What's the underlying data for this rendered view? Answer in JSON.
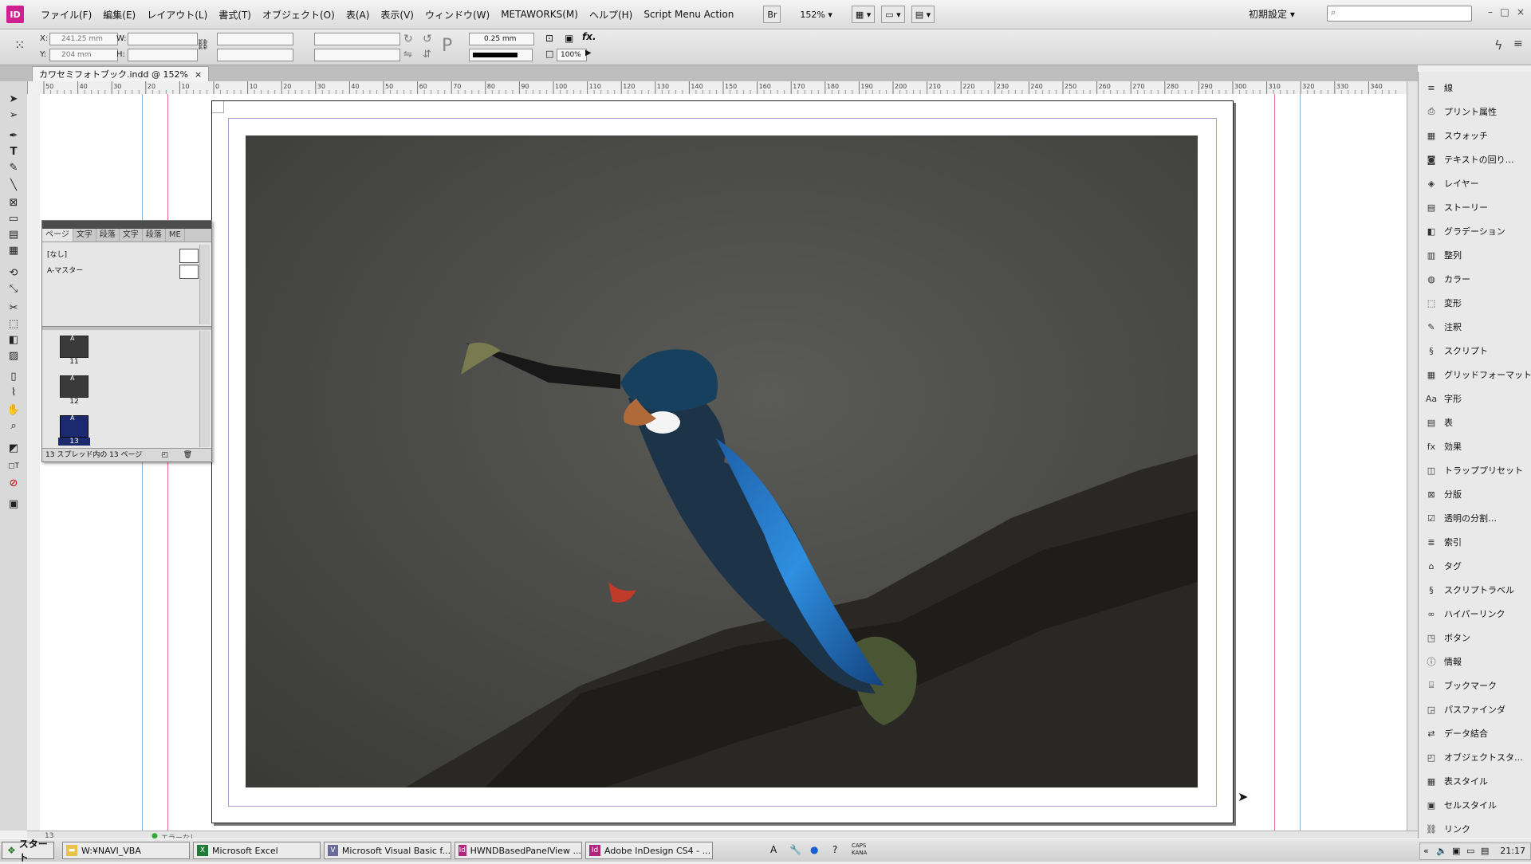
{
  "app": {
    "icon_label": "ID",
    "menus": [
      "ファイル(F)",
      "編集(E)",
      "レイアウト(L)",
      "書式(T)",
      "オブジェクト(O)",
      "表(A)",
      "表示(V)",
      "ウィンドウ(W)",
      "METAWORKS(M)",
      "ヘルプ(H)",
      "Script Menu Action"
    ],
    "bridge_label": "Br",
    "zoom": "152%",
    "workspace": "初期設定",
    "window_controls": [
      "–",
      "□",
      "×"
    ]
  },
  "control_panel": {
    "x_label": "X:",
    "x_value": "241.25 mm",
    "y_label": "Y:",
    "y_value": "204 mm",
    "w_label": "W:",
    "h_label": "H:",
    "stroke_weight": "0.25 mm",
    "opacity": "100%",
    "fx_label": "fx."
  },
  "document": {
    "tab_title": "カワセミフォトブック.indd @ 152%",
    "close_label": "×"
  },
  "pages_panel": {
    "tabs": [
      "ページ",
      "文字",
      "段落",
      "文字",
      "段落",
      "ME"
    ],
    "masters": [
      "[なし]",
      "A-マスター"
    ],
    "pages": [
      {
        "number": "11",
        "master": "A"
      },
      {
        "number": "12",
        "master": "A"
      },
      {
        "number": "13",
        "master": "A"
      }
    ],
    "footer": "13 スプレッド内の 13 ページ"
  },
  "right_dock": {
    "items": [
      {
        "label": "線",
        "icon": "stroke-icon"
      },
      {
        "label": "プリント属性",
        "icon": "print-attr-icon"
      },
      {
        "label": "スウォッチ",
        "icon": "swatch-icon"
      },
      {
        "label": "テキストの回り…",
        "icon": "text-wrap-icon"
      },
      {
        "label": "レイヤー",
        "icon": "layers-icon"
      },
      {
        "label": "ストーリー",
        "icon": "story-icon"
      },
      {
        "label": "グラデーション",
        "icon": "gradient-icon"
      },
      {
        "label": "整列",
        "icon": "align-icon"
      },
      {
        "label": "カラー",
        "icon": "color-icon"
      },
      {
        "label": "変形",
        "icon": "transform-icon"
      },
      {
        "label": "注釈",
        "icon": "notes-icon"
      },
      {
        "label": "スクリプト",
        "icon": "script-icon"
      },
      {
        "label": "グリッドフォーマット",
        "icon": "grid-format-icon"
      },
      {
        "label": "字形",
        "icon": "glyphs-icon"
      },
      {
        "label": "表",
        "icon": "table-icon"
      },
      {
        "label": "効果",
        "icon": "effects-icon"
      },
      {
        "label": "トラッププリセット",
        "icon": "trap-preset-icon"
      },
      {
        "label": "分版",
        "icon": "separations-icon"
      },
      {
        "label": "透明の分割…",
        "icon": "flattener-icon"
      },
      {
        "label": "索引",
        "icon": "index-icon"
      },
      {
        "label": "タグ",
        "icon": "tags-icon"
      },
      {
        "label": "スクリプトラベル",
        "icon": "script-label-icon"
      },
      {
        "label": "ハイパーリンク",
        "icon": "hyperlink-icon"
      },
      {
        "label": "ボタン",
        "icon": "button-icon"
      },
      {
        "label": "情報",
        "icon": "info-icon"
      },
      {
        "label": "ブックマーク",
        "icon": "bookmark-icon"
      },
      {
        "label": "パスファインダ",
        "icon": "pathfinder-icon"
      },
      {
        "label": "データ結合",
        "icon": "data-merge-icon"
      },
      {
        "label": "オブジェクトスタ…",
        "icon": "object-style-icon"
      },
      {
        "label": "表スタイル",
        "icon": "table-style-icon"
      },
      {
        "label": "セルスタイル",
        "icon": "cell-style-icon"
      },
      {
        "label": "リンク",
        "icon": "links-icon"
      }
    ]
  },
  "status": {
    "page_field": "13",
    "error_label": "エラーなし"
  },
  "taskbar": {
    "start_label": "スタート",
    "tasks": [
      {
        "label": "W:¥NAVI_VBA",
        "icon": "folder-icon",
        "color": "#e8c24a"
      },
      {
        "label": "Microsoft Excel",
        "icon": "excel-icon",
        "color": "#1f7a3a"
      },
      {
        "label": "Microsoft Visual Basic f...",
        "icon": "vb-icon",
        "color": "#6a6a9a"
      },
      {
        "label": "HWNDBasedPanelView ...",
        "icon": "indesign-icon",
        "color": "#b0247c"
      },
      {
        "label": "Adobe InDesign CS4 - ...",
        "icon": "indesign-icon",
        "color": "#b0247c"
      }
    ],
    "ime_label": "CAPS KANA",
    "clock": "21:17"
  },
  "ruler_ticks": [
    "50",
    "40",
    "30",
    "20",
    "10",
    "0",
    "10",
    "20",
    "30",
    "40",
    "50",
    "60",
    "70",
    "80",
    "90",
    "100",
    "110",
    "120",
    "130",
    "140",
    "150",
    "160",
    "170",
    "180",
    "190",
    "200",
    "210",
    "220",
    "230",
    "240",
    "250",
    "260",
    "270",
    "280",
    "290",
    "300",
    "310",
    "320",
    "330",
    "340"
  ]
}
